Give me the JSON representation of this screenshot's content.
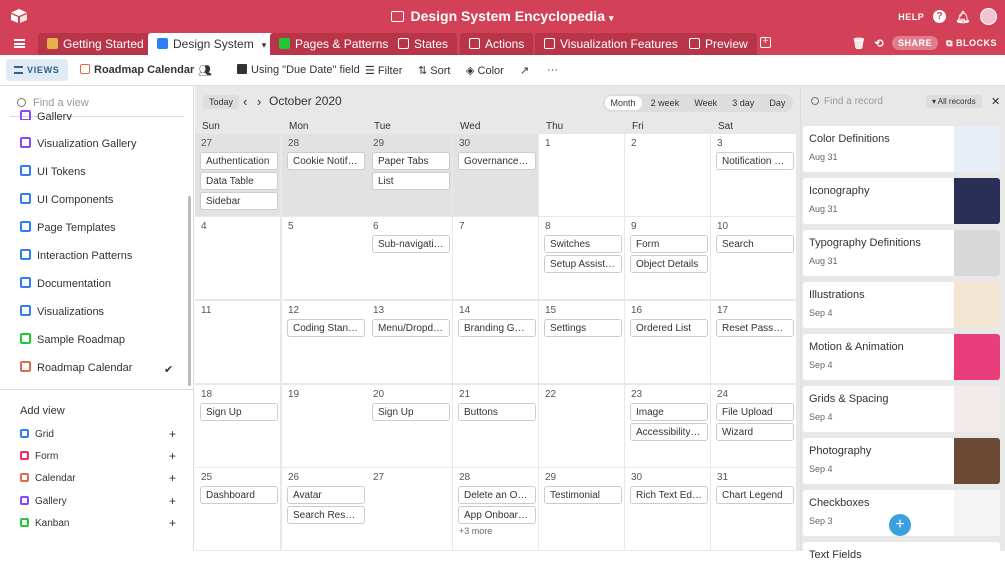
{
  "app": {
    "title": "Design System Encyclopedia",
    "help_label": "HELP",
    "share_label": "SHARE",
    "blocks_label": "BLOCKS",
    "accent": "#d24157"
  },
  "tabs": [
    {
      "label": "Getting Started",
      "icon": "rocket-icon",
      "color": "#e8b04a"
    },
    {
      "label": "Design System",
      "icon": "book-icon",
      "color": "#2d7ff9"
    },
    {
      "label": "Pages & Patterns",
      "icon": "green-book-icon",
      "color": "#20c933"
    },
    {
      "label": "States",
      "icon": "paperclip-icon",
      "color": "#ffffff"
    },
    {
      "label": "Actions",
      "icon": "paperclip-icon",
      "color": "#ffffff"
    },
    {
      "label": "Visualization Features",
      "icon": "paperclip-icon",
      "color": "#ffffff"
    },
    {
      "label": "Preview",
      "icon": "lock-icon",
      "color": "#ffffff"
    }
  ],
  "toolbar": {
    "views_label": "VIEWS",
    "view_name": "Roadmap Calendar",
    "using_field": "Using \"Due Date\" field",
    "filter": "Filter",
    "sort": "Sort",
    "color": "Color",
    "more": "···"
  },
  "sidebar": {
    "find_placeholder": "Find a view",
    "items": [
      {
        "label": "Gallery",
        "type": "gallery"
      },
      {
        "label": "Visualization Gallery",
        "type": "gallery"
      },
      {
        "label": "UI Tokens",
        "type": "grid"
      },
      {
        "label": "UI Components",
        "type": "grid"
      },
      {
        "label": "Page Templates",
        "type": "grid"
      },
      {
        "label": "Interaction Patterns",
        "type": "grid"
      },
      {
        "label": "Documentation",
        "type": "grid"
      },
      {
        "label": "Visualizations",
        "type": "grid"
      },
      {
        "label": "Sample Roadmap",
        "type": "kanban"
      },
      {
        "label": "Roadmap Calendar",
        "type": "calendar"
      }
    ],
    "add_view_label": "Add view",
    "add_items": [
      "Grid",
      "Form",
      "Calendar",
      "Gallery",
      "Kanban"
    ]
  },
  "calendar": {
    "today": "Today",
    "month_label": "October 2020",
    "modes": [
      "Month",
      "2 week",
      "Week",
      "3 day",
      "Day"
    ],
    "selected_mode": "Month",
    "weekdays": [
      "Sun",
      "Mon",
      "Tue",
      "Wed",
      "Thu",
      "Fri",
      "Sat"
    ],
    "weeks": [
      [
        {
          "day": "27",
          "dim": true,
          "records": [
            "Authentication",
            "Data Table",
            "Sidebar"
          ]
        },
        {
          "day": "28",
          "dim": true,
          "records": [
            "Cookie Notifica..."
          ]
        },
        {
          "day": "29",
          "dim": true,
          "records": [
            "Paper Tabs",
            "List"
          ]
        },
        {
          "day": "30",
          "dim": true,
          "records": [
            "Governance Pr..."
          ]
        },
        {
          "day": "1",
          "dim": false,
          "records": []
        },
        {
          "day": "2",
          "dim": false,
          "records": []
        },
        {
          "day": "3",
          "dim": false,
          "records": [
            "Notification Ce..."
          ]
        }
      ],
      [
        {
          "day": "4",
          "dim": false,
          "records": []
        },
        {
          "day": "5",
          "dim": false,
          "records": []
        },
        {
          "day": "6",
          "dim": false,
          "records": [
            "Sub-navigation..."
          ]
        },
        {
          "day": "7",
          "dim": false,
          "records": []
        },
        {
          "day": "8",
          "dim": false,
          "records": [
            "Switches",
            "Setup Assistant"
          ]
        },
        {
          "day": "9",
          "dim": false,
          "records": [
            "Form",
            "Object Details"
          ]
        },
        {
          "day": "10",
          "dim": false,
          "records": [
            "Search"
          ]
        }
      ],
      [
        {
          "day": "11",
          "dim": false,
          "records": []
        },
        {
          "day": "12",
          "dim": false,
          "records": [
            "Coding Standa..."
          ]
        },
        {
          "day": "13",
          "dim": false,
          "records": [
            "Menu/Dropdown"
          ]
        },
        {
          "day": "14",
          "dim": false,
          "records": [
            "Branding Guide..."
          ]
        },
        {
          "day": "15",
          "dim": false,
          "records": [
            "Settings"
          ]
        },
        {
          "day": "16",
          "dim": false,
          "records": [
            "Ordered List"
          ]
        },
        {
          "day": "17",
          "dim": false,
          "records": [
            "Reset Password"
          ]
        }
      ],
      [
        {
          "day": "18",
          "dim": false,
          "records": [
            "Sign Up"
          ]
        },
        {
          "day": "19",
          "dim": false,
          "records": []
        },
        {
          "day": "20",
          "dim": false,
          "records": [
            "Sign Up"
          ]
        },
        {
          "day": "21",
          "dim": false,
          "records": [
            "Buttons"
          ]
        },
        {
          "day": "22",
          "dim": false,
          "records": []
        },
        {
          "day": "23",
          "dim": false,
          "records": [
            "Image",
            "Accessibility G..."
          ]
        },
        {
          "day": "24",
          "dim": false,
          "records": [
            "File Upload",
            "Wizard"
          ]
        }
      ],
      [
        {
          "day": "25",
          "dim": false,
          "records": [
            "Dashboard"
          ]
        },
        {
          "day": "26",
          "dim": false,
          "records": [
            "Avatar",
            "Search Results"
          ]
        },
        {
          "day": "27",
          "dim": false,
          "records": []
        },
        {
          "day": "28",
          "dim": false,
          "records": [
            "Delete an Object",
            "App Onboarding"
          ],
          "more": "+3 more"
        },
        {
          "day": "29",
          "dim": false,
          "records": [
            "Testimonial"
          ]
        },
        {
          "day": "30",
          "dim": false,
          "records": [
            "Rich Text Editor"
          ]
        },
        {
          "day": "31",
          "dim": false,
          "records": [
            "Chart Legend"
          ]
        }
      ]
    ]
  },
  "records_panel": {
    "search_placeholder": "Find a record",
    "filter_label": "All records",
    "cards": [
      {
        "title": "Color Definitions",
        "date": "Aug 31",
        "thumb": "#e8eef7"
      },
      {
        "title": "Iconography",
        "date": "Aug 31",
        "thumb": "#2a2f55"
      },
      {
        "title": "Typography Definitions",
        "date": "Aug 31",
        "thumb": "#d8d8d8"
      },
      {
        "title": "Illustrations",
        "date": "Sep 4",
        "thumb": "#f2e6d2"
      },
      {
        "title": "Motion & Animation",
        "date": "Sep 4",
        "thumb": "#e83e7c"
      },
      {
        "title": "Grids & Spacing",
        "date": "Sep 4",
        "thumb": "#f3eaea"
      },
      {
        "title": "Photography",
        "date": "Sep 4",
        "thumb": "#6b4a35"
      },
      {
        "title": "Checkboxes",
        "date": "Sep 3",
        "thumb": "#f5f5f5"
      },
      {
        "title": "Text Fields",
        "date": "",
        "thumb": "#ffffff"
      }
    ]
  }
}
